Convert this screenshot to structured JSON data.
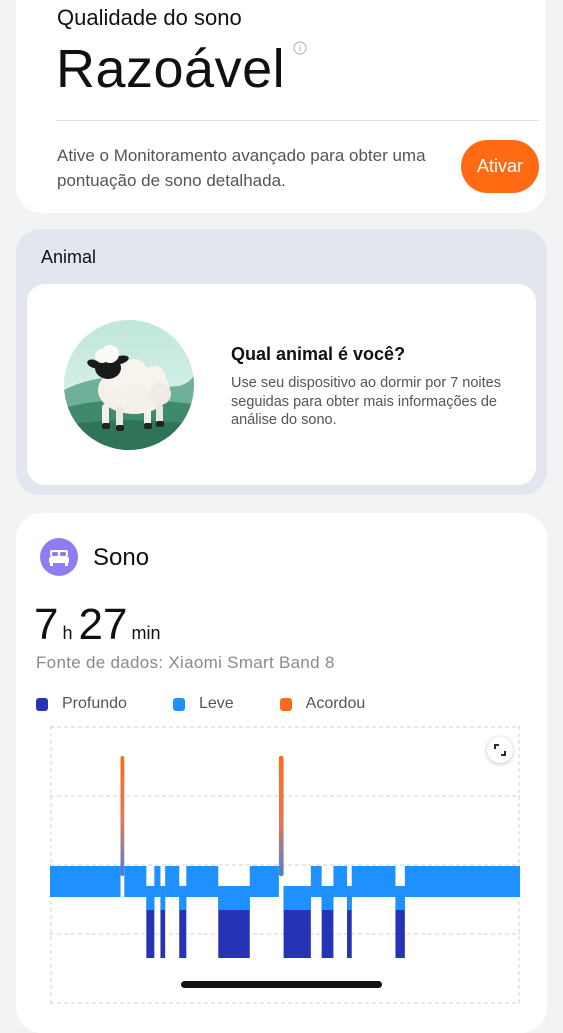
{
  "quality": {
    "title": "Qualidade do sono",
    "value": "Razoável",
    "description": "Ative o Monitoramento avançado para obter uma pontuação de sono detalhada.",
    "activate_label": "Ativar"
  },
  "animal": {
    "heading": "Animal",
    "question": "Qual animal é você?",
    "description": "Use seu dispositivo ao dormir por 7 noites seguidas para obter mais informações de análise do sono."
  },
  "sleep": {
    "title": "Sono",
    "hours": "7",
    "hours_unit": "h",
    "minutes": "27",
    "minutes_unit": "min",
    "source": "Fonte de dados: Xiaomi Smart Band 8",
    "legend": [
      {
        "label": "Profundo",
        "color": "#2733b5"
      },
      {
        "label": "Leve",
        "color": "#1e90ff"
      },
      {
        "label": "Acordou",
        "color": "#ff6a1a"
      }
    ]
  },
  "chart_data": {
    "type": "bar",
    "stage_levels": [
      "Acordou",
      "Leve",
      "Profundo"
    ],
    "timeline": [
      {
        "stage": "Leve",
        "start": 0.0,
        "end": 0.15
      },
      {
        "stage": "Acordou",
        "start": 0.15,
        "end": 0.158
      },
      {
        "stage": "Leve",
        "start": 0.158,
        "end": 0.205
      },
      {
        "stage": "Profundo",
        "start": 0.205,
        "end": 0.222
      },
      {
        "stage": "Leve",
        "start": 0.222,
        "end": 0.235
      },
      {
        "stage": "Profundo",
        "start": 0.235,
        "end": 0.245
      },
      {
        "stage": "Leve",
        "start": 0.245,
        "end": 0.275
      },
      {
        "stage": "Profundo",
        "start": 0.275,
        "end": 0.29
      },
      {
        "stage": "Leve",
        "start": 0.29,
        "end": 0.358
      },
      {
        "stage": "Profundo",
        "start": 0.358,
        "end": 0.425
      },
      {
        "stage": "Leve",
        "start": 0.425,
        "end": 0.487
      },
      {
        "stage": "Acordou",
        "start": 0.487,
        "end": 0.497
      },
      {
        "stage": "Profundo",
        "start": 0.497,
        "end": 0.555
      },
      {
        "stage": "Leve",
        "start": 0.555,
        "end": 0.578
      },
      {
        "stage": "Profundo",
        "start": 0.578,
        "end": 0.603
      },
      {
        "stage": "Leve",
        "start": 0.603,
        "end": 0.632
      },
      {
        "stage": "Profundo",
        "start": 0.632,
        "end": 0.642
      },
      {
        "stage": "Leve",
        "start": 0.642,
        "end": 0.735
      },
      {
        "stage": "Profundo",
        "start": 0.735,
        "end": 0.755
      },
      {
        "stage": "Leve",
        "start": 0.755,
        "end": 1.0
      }
    ],
    "grid": true
  }
}
